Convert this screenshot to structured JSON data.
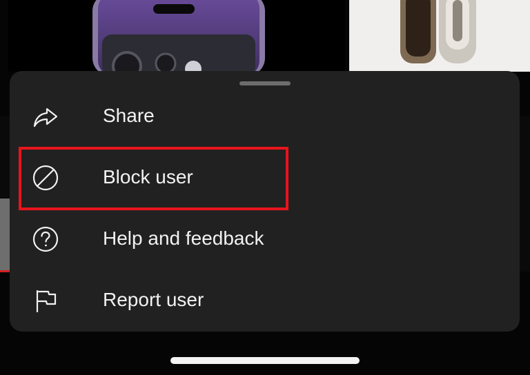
{
  "background": {
    "left_thumbnail": "phone-product-image",
    "right_thumbnail": "watch-product-image"
  },
  "sheet": {
    "items": [
      {
        "label": "Share",
        "icon": "share-icon"
      },
      {
        "label": "Block user",
        "icon": "block-icon"
      },
      {
        "label": "Help and feedback",
        "icon": "help-icon"
      },
      {
        "label": "Report user",
        "icon": "flag-icon"
      }
    ],
    "highlighted_item": "Block user",
    "highlight_color": "#e8141b",
    "background_color": "#212121"
  }
}
